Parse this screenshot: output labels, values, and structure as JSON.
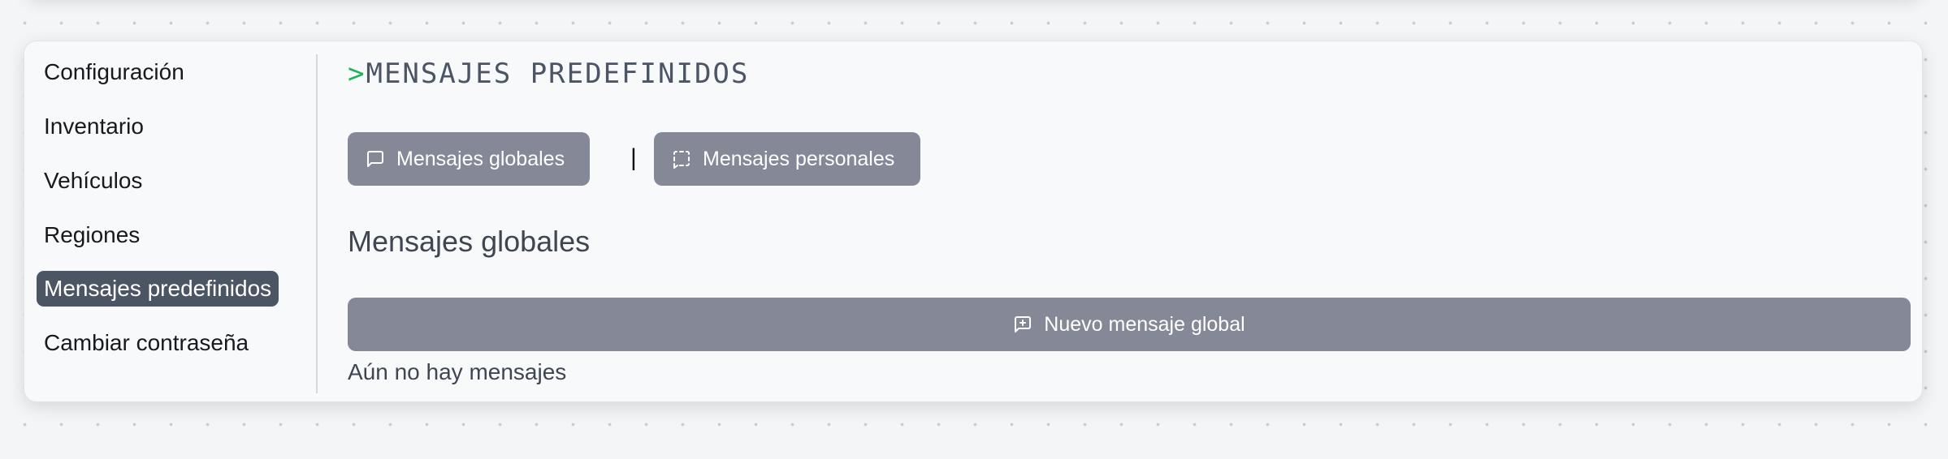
{
  "sidebar": {
    "items": [
      {
        "label": "Configuración",
        "active": false
      },
      {
        "label": "Inventario",
        "active": false
      },
      {
        "label": "Vehículos",
        "active": false
      },
      {
        "label": "Regiones",
        "active": false
      },
      {
        "label": "Mensajes predefinidos",
        "active": true
      },
      {
        "label": "Cambiar contraseña",
        "active": false
      }
    ]
  },
  "main": {
    "title_prompt": ">",
    "title": "MENSAJES PREDEFINIDOS",
    "tabs": [
      {
        "label": "Mensajes globales",
        "icon": "message-square-icon"
      },
      {
        "label": "Mensajes personales",
        "icon": "message-square-dashed-icon"
      }
    ],
    "tab_separator": "|",
    "section_heading": "Mensajes globales",
    "new_button": {
      "label": "Nuevo mensaje global",
      "icon": "message-square-plus-icon"
    },
    "empty_text": "Aún no hay mensajes"
  },
  "colors": {
    "accent_green": "#22b35a",
    "button_gray": "#858896",
    "active_item": "#4b5563"
  }
}
